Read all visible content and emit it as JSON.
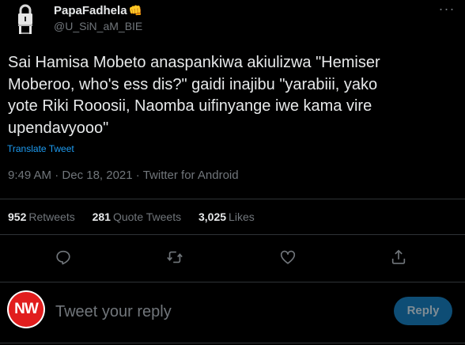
{
  "author": {
    "name": "PapaFadhela",
    "name_emoji": "👊",
    "handle": "@U_SiN_aM_BIE",
    "avatar_icon": "padlock-logo-icon"
  },
  "tweet": {
    "text": "Sai Hamisa Mobeto anaspankiwa akiulizwa \"Hemiser\nMoberoo, who's ess dis?\" gaidi inajibu \"yarabiii, yako\nyote Riki Rooosii, Naomba uifinyange iwe kama vire\nupendavyooo\"",
    "translate_label": "Translate Tweet",
    "time": "9:49 AM",
    "date": "Dec 18, 2021",
    "source": "Twitter for Android",
    "separator": "·"
  },
  "stats": {
    "retweets": {
      "count": "952",
      "label": "Retweets"
    },
    "quotes": {
      "count": "281",
      "label": "Quote Tweets"
    },
    "likes": {
      "count": "3,025",
      "label": "Likes"
    }
  },
  "actions": [
    "reply-icon",
    "retweet-icon",
    "like-icon",
    "share-icon"
  ],
  "reply_box": {
    "avatar_text": "NW",
    "placeholder": "Tweet your reply",
    "button_label": "Reply"
  },
  "colors": {
    "background": "#000000",
    "text": "#e7e9ea",
    "secondary": "#71767b",
    "link": "#1d9bf0",
    "reply_button_disabled": "#0e4d75",
    "avatar_red": "#e11d1d"
  }
}
